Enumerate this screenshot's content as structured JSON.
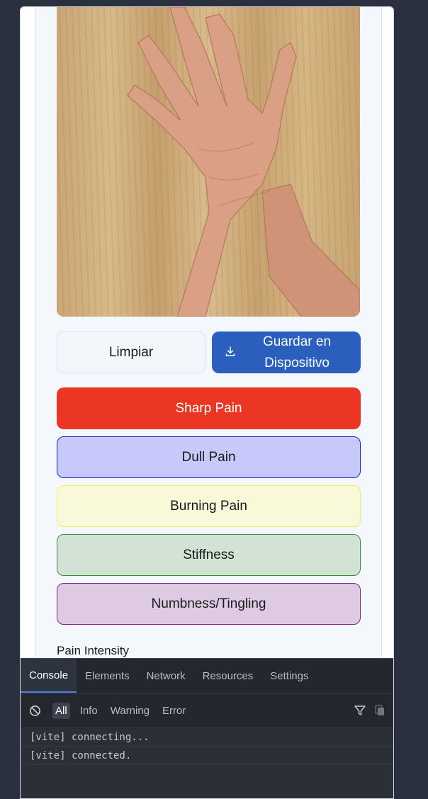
{
  "photo": {
    "subject": "hand-on-wood-photo"
  },
  "actions": {
    "clear_label": "Limpiar",
    "save_label": "Guardar en Dispositivo",
    "save_icon": "download-icon"
  },
  "pain_types": [
    {
      "label": "Sharp Pain",
      "color": "#ec3624"
    },
    {
      "label": "Dull Pain",
      "color": "#c8c9fb"
    },
    {
      "label": "Burning Pain",
      "color": "#f7f9d9"
    },
    {
      "label": "Stiffness",
      "color": "#d2e2d4"
    },
    {
      "label": "Numbness/Tingling",
      "color": "#decbe3"
    }
  ],
  "intensity": {
    "label": "Pain Intensity"
  },
  "devtools": {
    "tabs": [
      "Console",
      "Elements",
      "Network",
      "Resources",
      "Settings"
    ],
    "active_tab": "Console",
    "levels": [
      "All",
      "Info",
      "Warning",
      "Error"
    ],
    "active_level": "All",
    "logs": [
      "[vite] connecting...",
      "[vite] connected."
    ]
  }
}
